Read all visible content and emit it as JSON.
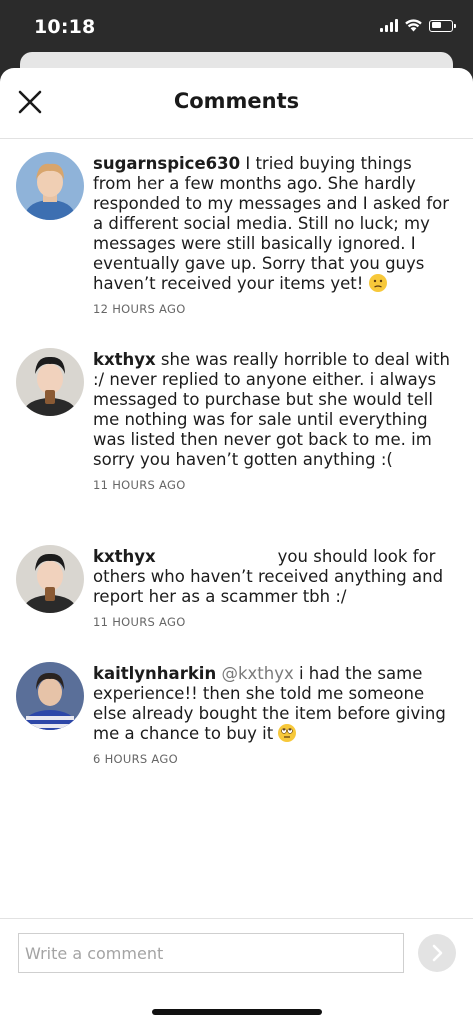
{
  "status_bar": {
    "time": "10:18"
  },
  "header": {
    "title": "Comments"
  },
  "comments": [
    {
      "username": "sugarnspice630",
      "text": " I tried buying things from her a few months ago. She hardly responded to my messages and I asked for a different social media. Still no luck; my messages were still basically ignored. I eventually gave up. Sorry that you guys haven’t received your items yet! ",
      "emoji": "confused-face",
      "time": "12 HOURS AGO"
    },
    {
      "username": "kxthyx",
      "text": " she was really horrible to deal with :/ never replied to anyone either. i always messaged to purchase but she would tell me nothing was for sale until everything was listed then never got back to me. im sorry you haven’t gotten anything :(",
      "time": "11 HOURS AGO"
    },
    {
      "username": "kxthyx",
      "text": "you should look for others who haven’t received anything and report her as a scammer tbh :/",
      "time": "11 HOURS AGO"
    },
    {
      "username": "kaitlynharkin",
      "mention": "@kxthyx",
      "text": " i had the same experience!! then she told me someone else already bought the item before giving me a chance to buy it ",
      "emoji": "eye-roll-face",
      "time": "6 HOURS AGO"
    }
  ],
  "footer": {
    "input_placeholder": "Write a comment"
  },
  "colors": {
    "background_dark": "#2b2b2b",
    "sheet": "#ffffff",
    "emoji": "#f7c83a"
  }
}
